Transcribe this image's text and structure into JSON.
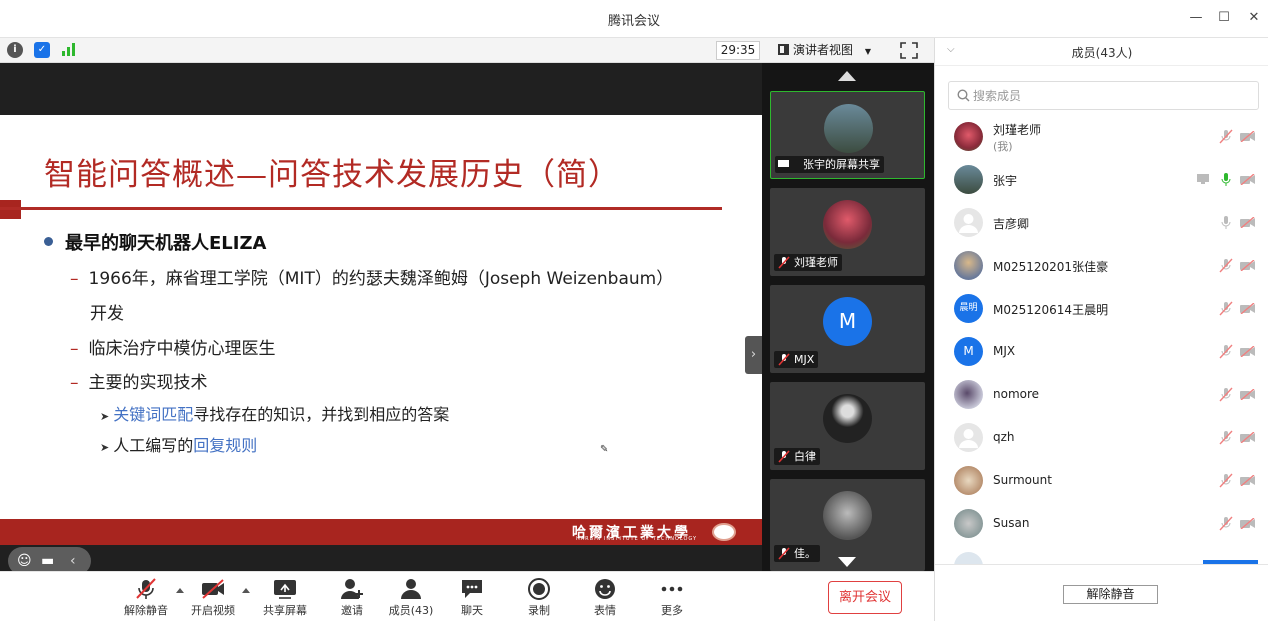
{
  "window": {
    "title": "腾讯会议"
  },
  "toolbar": {
    "timer": "29:35",
    "view_label": "演讲者视图"
  },
  "slide": {
    "title": "智能问答概述—问答技术发展历史（简）",
    "bullet": "最早的聊天机器人ELIZA",
    "sub1_line1": "1966年，麻省理工学院（MIT）的约瑟夫魏泽鲍姆（Joseph Weizenbaum）",
    "sub1_line2": "开发",
    "sub2": "临床治疗中模仿心理医生",
    "sub3": "主要的实现技术",
    "subsub1_link": "关键词匹配",
    "subsub1_rest": "寻找存在的知识，并找到相应的答案",
    "subsub2_pre": "人工编写的",
    "subsub2_link": "回复规则",
    "footer_school": "哈爾濱工業大學",
    "footer_en": "HARBIN INSTITUTE OF TECHNOLOGY"
  },
  "videos": [
    {
      "label": "张宇的屏幕共享"
    },
    {
      "label": "刘瑾老师"
    },
    {
      "label": "MJX",
      "avatar_letter": "M"
    },
    {
      "label": "白律"
    },
    {
      "label": "佳。"
    }
  ],
  "bottombar": {
    "unmute": "解除静音",
    "video": "开启视频",
    "share": "共享屏幕",
    "invite": "邀请",
    "members": "成员(43)",
    "chat": "聊天",
    "record": "录制",
    "emoji": "表情",
    "more": "更多",
    "leave": "离开会议"
  },
  "panel": {
    "title": "成员(43人)",
    "search_placeholder": "搜索成员",
    "members": [
      {
        "name": "刘瑾老师",
        "sub": "(我)"
      },
      {
        "name": "张宇"
      },
      {
        "name": "吉彦卿"
      },
      {
        "name": "M025120201张佳豪"
      },
      {
        "name": "M025120614王晨明",
        "avatar_text": "晨明"
      },
      {
        "name": "MJX",
        "avatar_text": "M"
      },
      {
        "name": "nomore"
      },
      {
        "name": "qzh"
      },
      {
        "name": "Surmount"
      },
      {
        "name": "Susan"
      }
    ],
    "unmute_all": "解除静音"
  },
  "colors": {
    "accent_red": "#b22a24",
    "link_blue": "#4472c4",
    "avatar_blue": "#1a73e8",
    "leave_red": "#e03434"
  }
}
